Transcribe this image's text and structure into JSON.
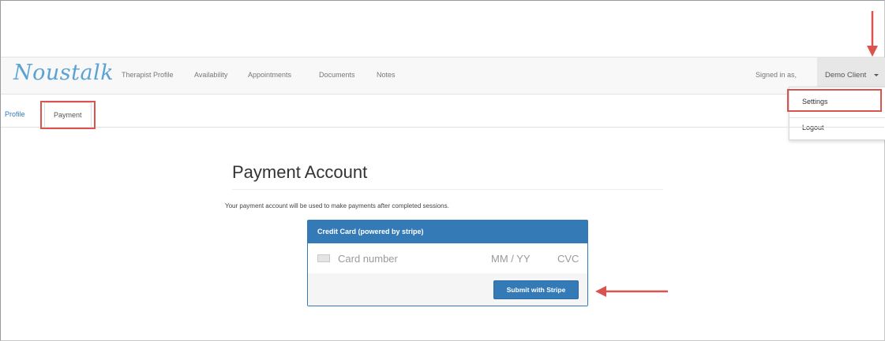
{
  "navbar": {
    "brand": "Noustalk",
    "links": [
      "Therapist Profile",
      "Availability",
      "Appointments",
      "Documents",
      "Notes"
    ],
    "signed_in_label": "Signed in as,",
    "user_name": "Demo Client"
  },
  "user_menu": {
    "items": [
      "Settings",
      "Logout"
    ]
  },
  "subnav": {
    "profile": "Profile",
    "payment": "Payment"
  },
  "main": {
    "title": "Payment Account",
    "description": "Your payment account will be used to make payments after completed sessions."
  },
  "card_panel": {
    "heading": "Credit Card (powered by stripe)",
    "card_number_placeholder": "Card number",
    "expiry_placeholder": "MM / YY",
    "cvc_placeholder": "CVC",
    "submit_label": "Submit with Stripe"
  },
  "colors": {
    "brand": "#5aa2d4",
    "primary": "#337ab7",
    "annotation": "#d9534f"
  },
  "icons": [
    "caret-down-icon",
    "credit-card-icon",
    "annotation-arrow-down",
    "annotation-arrow-left"
  ]
}
